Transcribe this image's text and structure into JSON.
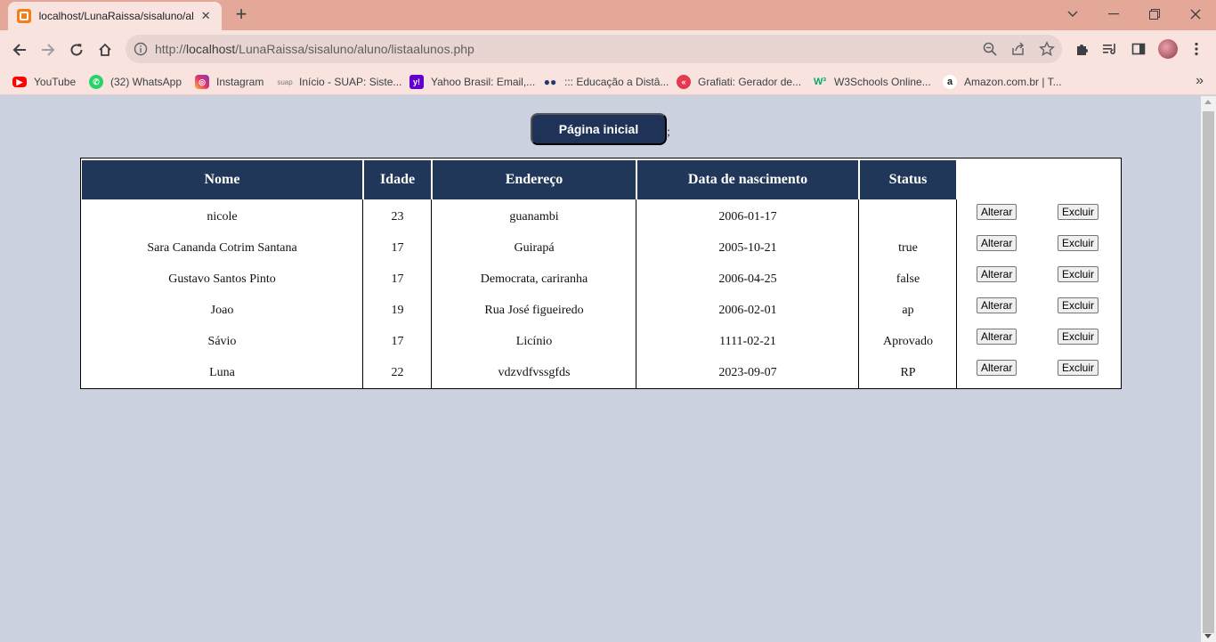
{
  "browser": {
    "tab_title": "localhost/LunaRaissa/sisaluno/alu",
    "url_prefix": "http://",
    "url_host": "localhost",
    "url_path": "/LunaRaissa/sisaluno/aluno/listaalunos.php",
    "bookmarks": [
      {
        "label": "YouTube",
        "icon": "youtube-icon",
        "color": "#ff0000"
      },
      {
        "label": "(32) WhatsApp",
        "icon": "whatsapp-icon",
        "color": "#25d366"
      },
      {
        "label": "Instagram",
        "icon": "instagram-icon",
        "color": "#d6249f"
      },
      {
        "label": "Início - SUAP: Siste...",
        "icon": "suap-icon",
        "color": "#9e9e9e"
      },
      {
        "label": "Yahoo Brasil: Email,...",
        "icon": "yahoo-icon",
        "color": "#6001d2"
      },
      {
        "label": "::: Educação a Distâ...",
        "icon": "ead-icon",
        "color": "#1e88e5"
      },
      {
        "label": "Grafiati: Gerador de...",
        "icon": "grafiati-icon",
        "color": "#e53950"
      },
      {
        "label": "W3Schools Online...",
        "icon": "w3schools-icon",
        "color": "#04aa6d"
      },
      {
        "label": "Amazon.com.br | T...",
        "icon": "amazon-icon",
        "color": "#222222"
      }
    ]
  },
  "page": {
    "home_button": "Página inicial",
    "stray_text": ";"
  },
  "table": {
    "headers": [
      "Nome",
      "Idade",
      "Endereço",
      "Data de nascimento",
      "Status"
    ],
    "rows": [
      {
        "nome": "nicole",
        "idade": "23",
        "endereco": "guanambi",
        "nascimento": "2006-01-17",
        "status": ""
      },
      {
        "nome": "Sara Cananda Cotrim Santana",
        "idade": "17",
        "endereco": "Guirapá",
        "nascimento": "2005-10-21",
        "status": "true"
      },
      {
        "nome": "Gustavo Santos Pinto",
        "idade": "17",
        "endereco": "Democrata, cariranha",
        "nascimento": "2006-04-25",
        "status": "false"
      },
      {
        "nome": "Joao",
        "idade": "19",
        "endereco": "Rua José figueiredo",
        "nascimento": "2006-02-01",
        "status": "ap"
      },
      {
        "nome": "Sávio",
        "idade": "17",
        "endereco": "Licínio",
        "nascimento": "1111-02-21",
        "status": "Aprovado"
      },
      {
        "nome": "Luna",
        "idade": "22",
        "endereco": "vdzvdfvssgfds",
        "nascimento": "2023-09-07",
        "status": "RP"
      }
    ],
    "alter_label": "Alterar",
    "delete_label": "Excluir"
  },
  "colors": {
    "header_bg": "#213759",
    "button_bg": "#1f3358",
    "page_bg": "#cbd1df",
    "chrome_tabstrip": "#e3a897",
    "chrome_toolbar": "#f9e3de"
  }
}
